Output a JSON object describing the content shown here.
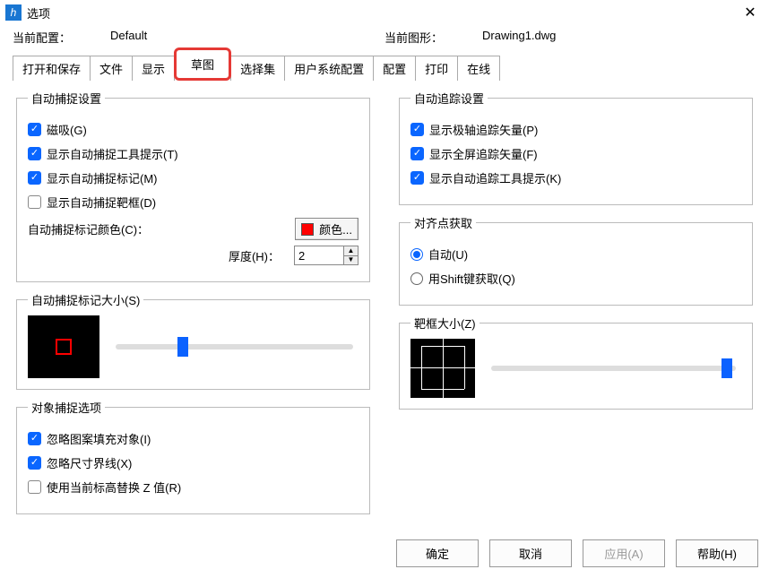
{
  "title": "选项",
  "currentConfigLabel": "当前配置：",
  "currentConfigValue": "Default",
  "currentDrawingLabel": "当前图形：",
  "currentDrawingValue": "Drawing1.dwg",
  "tabs": {
    "openSave": "打开和保存",
    "file": "文件",
    "display": "显示",
    "sketch": "草图",
    "selection": "选择集",
    "userSys": "用户系统配置",
    "config": "配置",
    "print": "打印",
    "online": "在线"
  },
  "autoSnap": {
    "legend": "自动捕捉设置",
    "magnet": "磁吸(G)",
    "tooltip": "显示自动捕捉工具提示(T)",
    "marker": "显示自动捕捉标记(M)",
    "target": "显示自动捕捉靶框(D)",
    "colorLabel": "自动捕捉标记颜色(C)：",
    "colorBtn": "颜色...",
    "thicknessLabel": "厚度(H)：",
    "thicknessValue": "2"
  },
  "autoTrack": {
    "legend": "自动追踪设置",
    "polar": "显示极轴追踪矢量(P)",
    "fullscreen": "显示全屏追踪矢量(F)",
    "tooltip": "显示自动追踪工具提示(K)"
  },
  "align": {
    "legend": "对齐点获取",
    "auto": "自动(U)",
    "shift": "用Shift键获取(Q)"
  },
  "markerSize": {
    "legend": "自动捕捉标记大小(S)"
  },
  "targetSize": {
    "legend": "靶框大小(Z)"
  },
  "objSnap": {
    "legend": "对象捕捉选项",
    "hatch": "忽略图案填充对象(I)",
    "dim": "忽略尺寸界线(X)",
    "elev": "使用当前标高替换 Z 值(R)"
  },
  "buttons": {
    "ok": "确定",
    "cancel": "取消",
    "apply": "应用(A)",
    "help": "帮助(H)"
  }
}
